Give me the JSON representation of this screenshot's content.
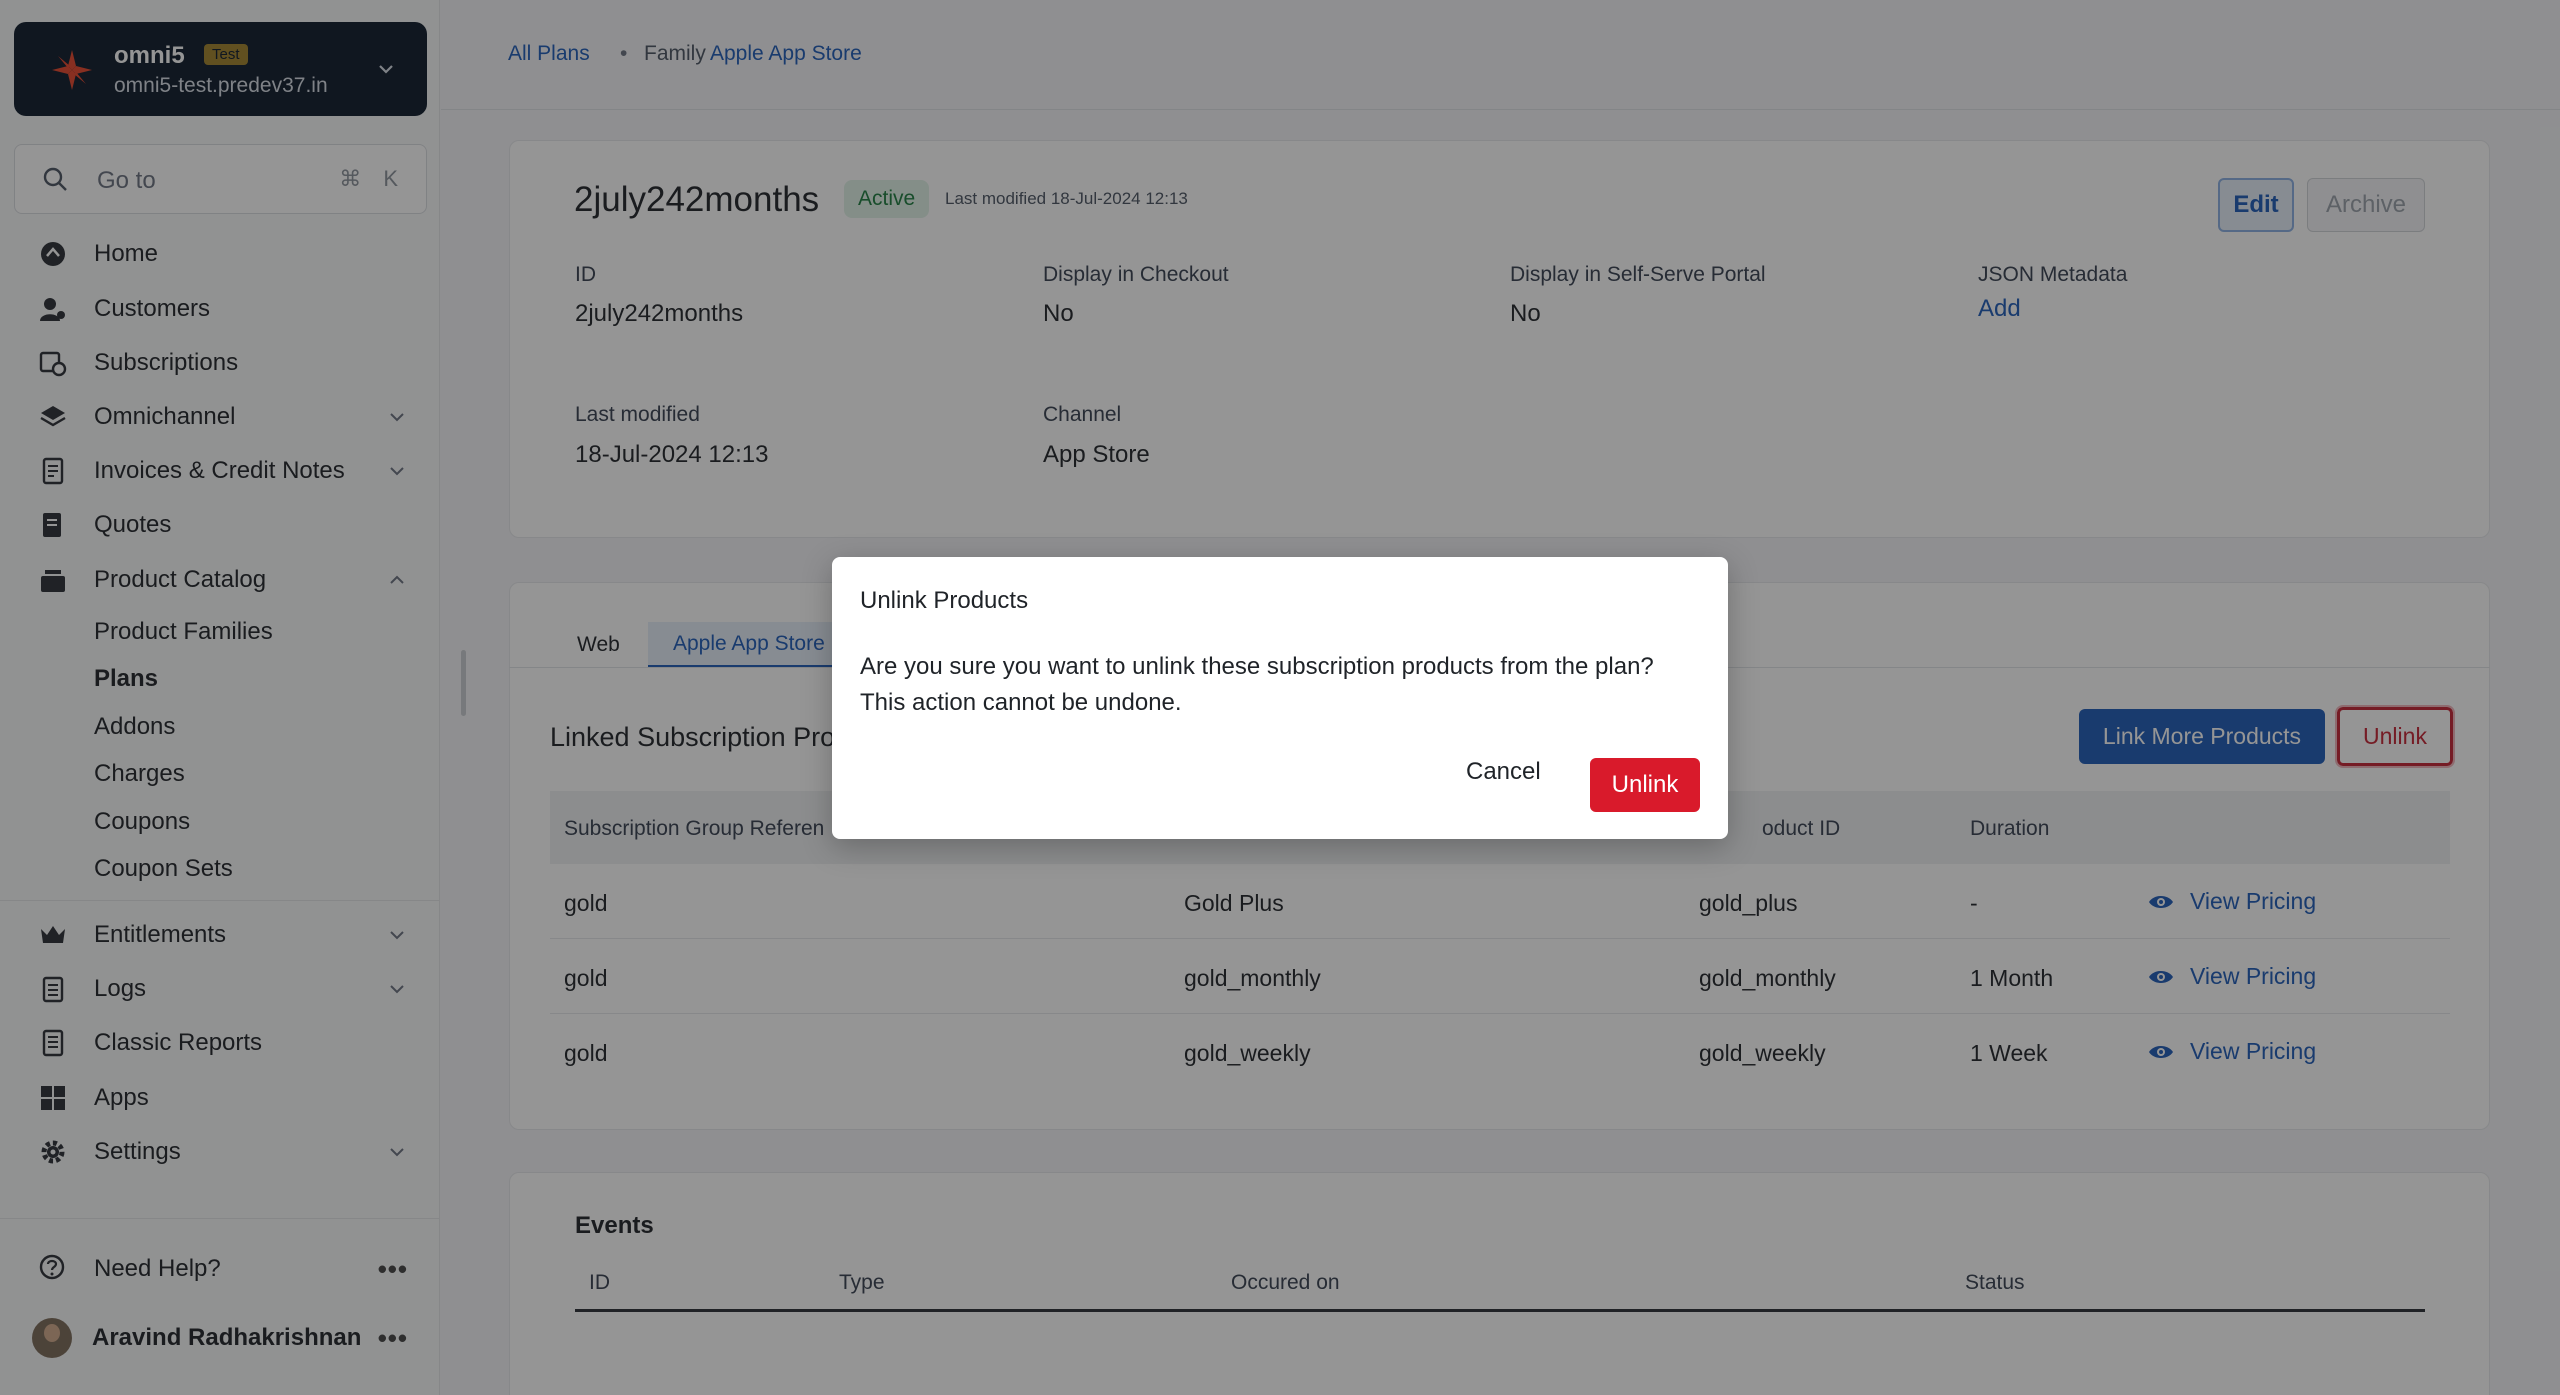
{
  "site": {
    "name": "omni5",
    "badge": "Test",
    "domain": "omni5-test.predev37.in"
  },
  "search": {
    "placeholder": "Go to",
    "shortcut": "⌘ K"
  },
  "nav": {
    "items": [
      {
        "label": "Home",
        "icon": "home-icon"
      },
      {
        "label": "Customers",
        "icon": "customers-icon"
      },
      {
        "label": "Subscriptions",
        "icon": "subscriptions-icon"
      },
      {
        "label": "Omnichannel",
        "icon": "layers-icon"
      },
      {
        "label": "Invoices & Credit Notes",
        "icon": "invoice-icon"
      },
      {
        "label": "Quotes",
        "icon": "quotes-icon"
      },
      {
        "label": "Product Catalog",
        "icon": "catalog-icon"
      },
      {
        "label": "Entitlements",
        "icon": "crown-icon"
      },
      {
        "label": "Logs",
        "icon": "logs-icon"
      },
      {
        "label": "Classic Reports",
        "icon": "reports-icon"
      },
      {
        "label": "Apps",
        "icon": "apps-icon"
      },
      {
        "label": "Settings",
        "icon": "gear-icon"
      }
    ],
    "catalog_sub": [
      {
        "label": "Product Families"
      },
      {
        "label": "Plans"
      },
      {
        "label": "Addons"
      },
      {
        "label": "Charges"
      },
      {
        "label": "Coupons"
      },
      {
        "label": "Coupon Sets"
      }
    ],
    "help": "Need Help?",
    "user": "Aravind Radhakrishnan",
    "more": "•••"
  },
  "breadcrumb": {
    "all_plans": "All Plans",
    "sep": "•",
    "family_label": "Family",
    "family_name": "Apple App Store"
  },
  "plan": {
    "title": "2july242months",
    "status": "Active",
    "last_modified_short": "Last modified 18-Jul-2024 12:13",
    "edit": "Edit",
    "archive": "Archive",
    "fields": {
      "id_label": "ID",
      "id_value": "2july242months",
      "checkout_label": "Display in Checkout",
      "checkout_value": "No",
      "portal_label": "Display in Self-Serve Portal",
      "portal_value": "No",
      "json_label": "JSON Metadata",
      "json_value": "Add",
      "lastmod_label": "Last modified",
      "lastmod_value": "18-Jul-2024 12:13",
      "channel_label": "Channel",
      "channel_value": "App Store"
    }
  },
  "tabs": [
    {
      "label": "Web"
    },
    {
      "label": "Apple App Store"
    }
  ],
  "linked": {
    "title": "Linked Subscription Pro",
    "link_more": "Link More Products",
    "unlink": "Unlink",
    "columns": [
      "Subscription Group Referen",
      "",
      "oduct ID",
      "Duration"
    ],
    "view_pricing": "View Pricing",
    "rows": [
      {
        "group": "gold",
        "name": "Gold Plus",
        "product_id": "gold_plus",
        "duration": "-"
      },
      {
        "group": "gold",
        "name": "gold_monthly",
        "product_id": "gold_monthly",
        "duration": "1 Month"
      },
      {
        "group": "gold",
        "name": "gold_weekly",
        "product_id": "gold_weekly",
        "duration": "1 Week"
      }
    ]
  },
  "events": {
    "title": "Events",
    "columns": [
      "ID",
      "Type",
      "Occured on",
      "Status"
    ]
  },
  "modal": {
    "title": "Unlink Products",
    "body_line1": "Are you sure you want to unlink these subscription products from the plan?",
    "body_line2": "This action cannot be undone.",
    "cancel": "Cancel",
    "confirm": "Unlink"
  },
  "colors": {
    "primary": "#1e5bb8",
    "danger": "#d91a2b",
    "sidebar_header": "#0d1b2a"
  }
}
